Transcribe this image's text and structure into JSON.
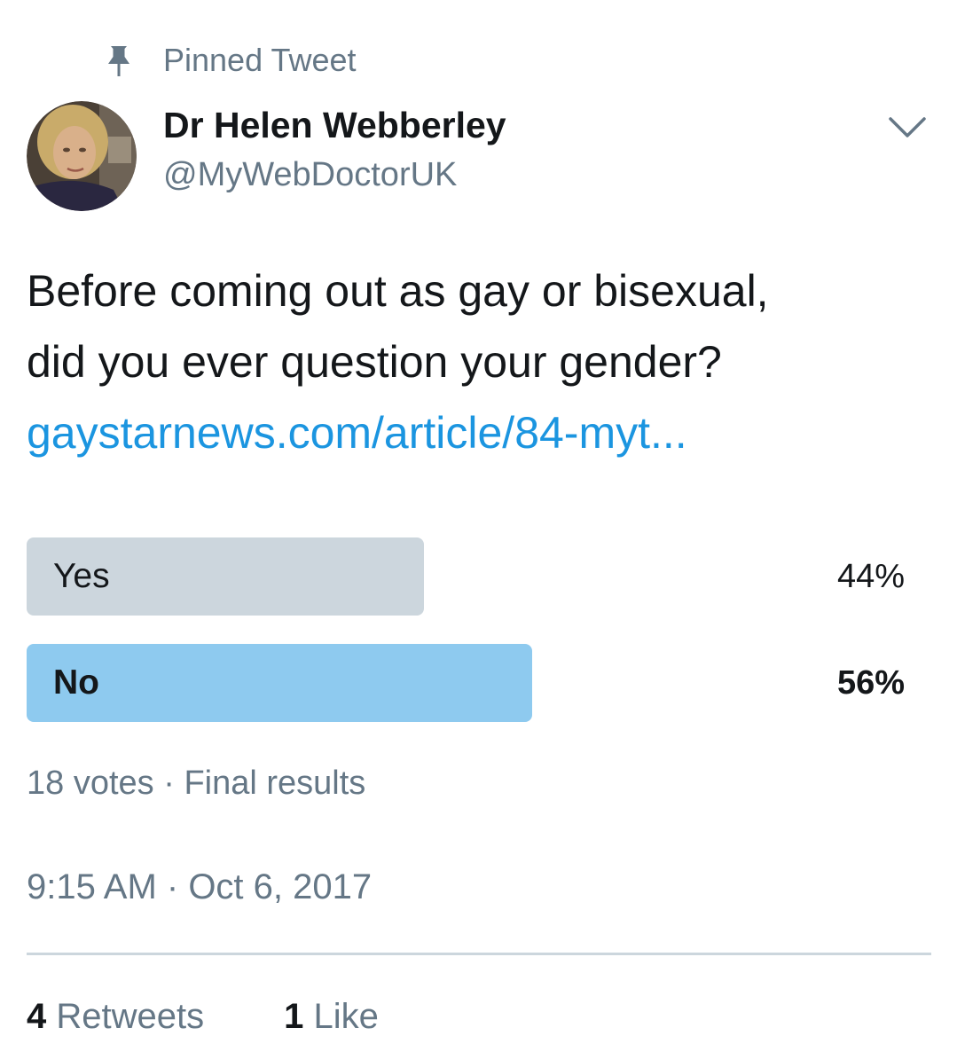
{
  "pinned": {
    "label": "Pinned Tweet",
    "icon": "pin-icon"
  },
  "author": {
    "display_name": "Dr Helen Webberley",
    "handle": "@MyWebDoctorUK"
  },
  "tweet": {
    "text_lines": [
      "Before coming out as gay or bisexual,",
      "did you ever question your gender?"
    ],
    "link": "gaystarnews.com/article/84-myt..."
  },
  "poll": {
    "options": [
      {
        "label": "Yes",
        "percent_text": "44%",
        "percent": 44,
        "winner": false
      },
      {
        "label": "No",
        "percent_text": "56%",
        "percent": 56,
        "winner": true
      }
    ],
    "votes": "18 votes",
    "status": "Final results"
  },
  "timestamp": {
    "time": "9:15 AM",
    "date": "Oct 6, 2017"
  },
  "stats": {
    "retweets_count": "4",
    "retweets_label": "Retweets",
    "likes_count": "1",
    "likes_label": "Like"
  },
  "colors": {
    "text_primary": "#14171a",
    "text_secondary": "#657786",
    "link": "#1b95e0",
    "poll_bar_loser": "#ccd6dd",
    "poll_bar_winner": "#8ecaef",
    "divider": "#ccd6dd"
  }
}
